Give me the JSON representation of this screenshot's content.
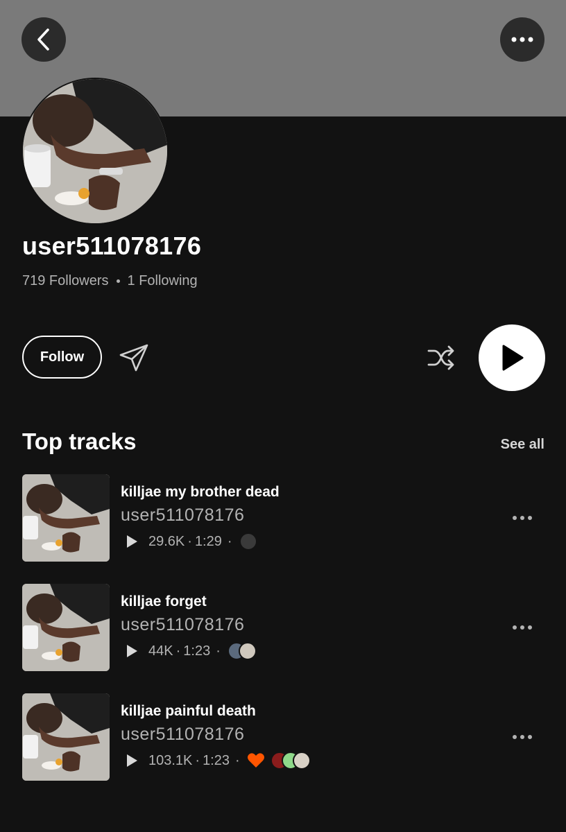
{
  "profile": {
    "username": "user511078176",
    "followers": "719 Followers",
    "following": "1 Following"
  },
  "actions": {
    "follow_label": "Follow"
  },
  "top_tracks": {
    "title": "Top tracks",
    "see_all": "See all",
    "tracks": [
      {
        "title": "killjae my brother dead",
        "artist": "user511078176",
        "plays": "29.6K",
        "duration": "1:29",
        "liked": false,
        "reposters": [
          "#3a3a3a"
        ]
      },
      {
        "title": "killjae forget",
        "artist": "user511078176",
        "plays": "44K",
        "duration": "1:23",
        "liked": false,
        "reposters": [
          "#5b6a7d",
          "#cfc8bd"
        ]
      },
      {
        "title": "killjae painful death",
        "artist": "user511078176",
        "plays": "103.1K",
        "duration": "1:23",
        "liked": true,
        "reposters": [
          "#8a1c1c",
          "#8fd88a",
          "#d8d1c6"
        ]
      }
    ]
  },
  "colors": {
    "background": "#121212",
    "banner": "#7a7a7a",
    "like": "#ff5500",
    "secondary_text": "#b3b3b3"
  }
}
